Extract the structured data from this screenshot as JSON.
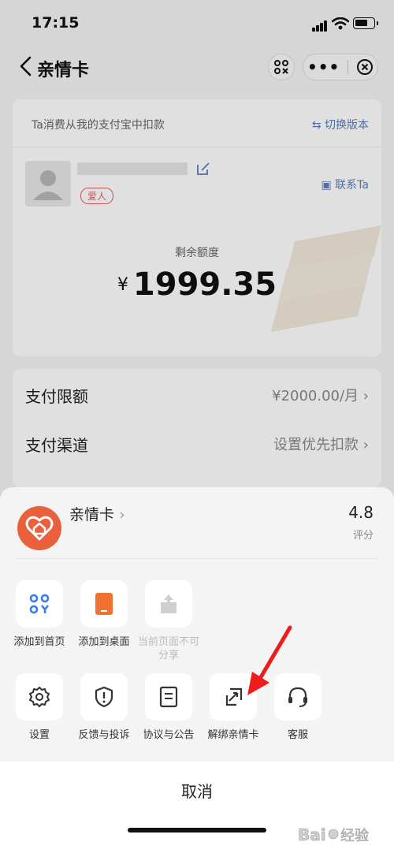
{
  "status": {
    "time": "17:15"
  },
  "nav": {
    "title": "亲情卡"
  },
  "card": {
    "subtitle": "Ta消费从我的支付宝中扣款",
    "switch_label": "切换版本",
    "tag": "爱人",
    "contact_label": "联系Ta",
    "balance_label": "剩余额度",
    "currency": "¥",
    "balance": "1999.35"
  },
  "rows": [
    {
      "label": "支付限额",
      "value": "¥2000.00/月"
    },
    {
      "label": "支付渠道",
      "value": "设置优先扣款"
    }
  ],
  "sheet": {
    "app_name": "亲情卡",
    "rating": "4.8",
    "rating_label": "评分",
    "actions_row1": [
      {
        "label": "添加到首页",
        "icon": "grid-icon",
        "enabled": true
      },
      {
        "label": "添加到桌面",
        "icon": "tablet-icon",
        "enabled": true
      },
      {
        "label": "当前页面不可分享",
        "icon": "share-icon",
        "enabled": false
      }
    ],
    "actions_row2": [
      {
        "label": "设置",
        "icon": "gear-icon"
      },
      {
        "label": "反馈与投诉",
        "icon": "shield-icon"
      },
      {
        "label": "协议与公告",
        "icon": "document-icon"
      },
      {
        "label": "解绑亲情卡",
        "icon": "unlink-icon"
      },
      {
        "label": "客服",
        "icon": "headset-icon"
      }
    ],
    "cancel_label": "取消"
  },
  "colors": {
    "accent": "#e8603c",
    "link": "#5b7fb8",
    "tile_blue": "#3b7bf0",
    "tile_orange": "#f07030",
    "arrow": "#ee1c1c"
  },
  "brand": {
    "text": "Bai 经验"
  }
}
